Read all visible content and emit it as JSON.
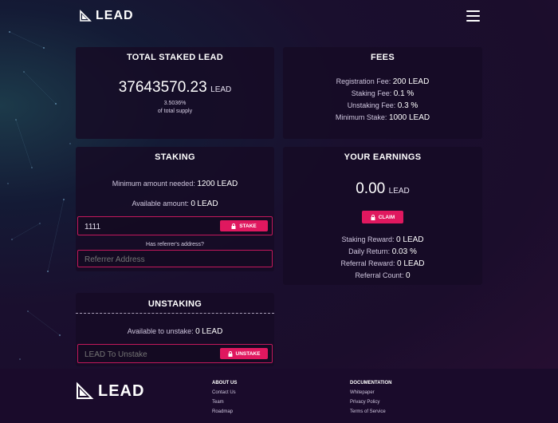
{
  "header": {
    "logo_text": "LEAD"
  },
  "total_staked": {
    "title": "TOTAL STAKED LEAD",
    "amount": "37643570.23",
    "unit": "LEAD",
    "percent": "3.5036%",
    "percent_label": "of total supply"
  },
  "fees": {
    "title": "FEES",
    "registration_label": "Registration Fee:",
    "registration_value": "200 LEAD",
    "staking_label": "Staking Fee:",
    "staking_value": "0.1 %",
    "unstaking_label": "Unstaking Fee:",
    "unstaking_value": "0.3 %",
    "min_stake_label": "Minimum Stake:",
    "min_stake_value": "1000 LEAD"
  },
  "staking": {
    "title": "STAKING",
    "min_label": "Minimum amount needed:",
    "min_value": "1200",
    "min_unit": "LEAD",
    "available_label": "Available amount:",
    "available_value": "0",
    "available_unit": "LEAD",
    "amount_input_value": "1111",
    "stake_button": "STAKE",
    "referrer_question": "Has referrer's address?",
    "referrer_placeholder": "Referrer Address"
  },
  "earnings": {
    "title": "YOUR EARNINGS",
    "amount": "0.00",
    "unit": "LEAD",
    "claim_button": "CLAIM",
    "staking_reward_label": "Staking Reward:",
    "staking_reward_value": "0 LEAD",
    "daily_return_label": "Daily Return:",
    "daily_return_value": "0.03 %",
    "referral_reward_label": "Referral Reward:",
    "referral_reward_value": "0 LEAD",
    "referral_count_label": "Referral Count:",
    "referral_count_value": "0"
  },
  "unstaking": {
    "title": "UNSTAKING",
    "available_label": "Available to unstake:",
    "available_value": "0",
    "available_unit": "LEAD",
    "input_placeholder": "LEAD To Unstake",
    "unstake_button": "UNSTAKE"
  },
  "footer": {
    "logo_text": "LEAD",
    "about_title": "ABOUT US",
    "about_links": [
      "Contact Us",
      "Team",
      "Roadmap"
    ],
    "docs_title": "DOCUMENTATION",
    "docs_links": [
      "Whitepaper",
      "Privacy Policy",
      "Terms of Service"
    ]
  },
  "colors": {
    "accent": "#e0185f",
    "card": "#160b24",
    "footer": "#1a0b2b"
  }
}
